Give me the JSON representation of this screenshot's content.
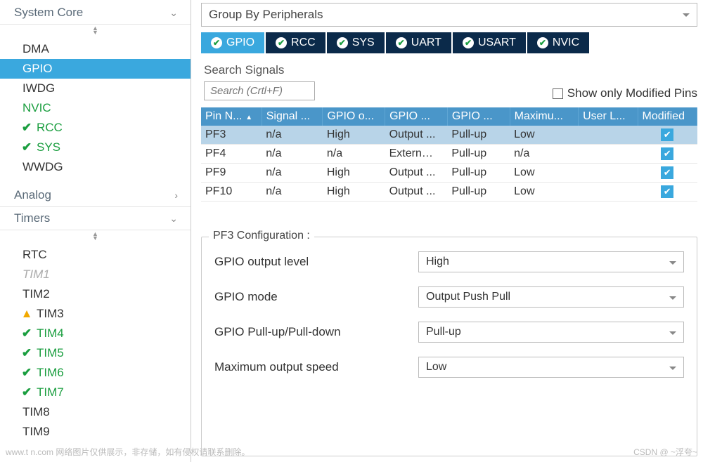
{
  "sidebar": {
    "cats": [
      {
        "name": "System Core",
        "open": true,
        "items": [
          {
            "label": "DMA",
            "style": "",
            "icon": ""
          },
          {
            "label": "GPIO",
            "style": "sel",
            "icon": ""
          },
          {
            "label": "IWDG",
            "style": "",
            "icon": ""
          },
          {
            "label": "NVIC",
            "style": "green",
            "icon": ""
          },
          {
            "label": "RCC",
            "style": "green",
            "icon": "check"
          },
          {
            "label": "SYS",
            "style": "green",
            "icon": "check"
          },
          {
            "label": "WWDG",
            "style": "",
            "icon": ""
          }
        ]
      },
      {
        "name": "Analog",
        "open": false,
        "items": []
      },
      {
        "name": "Timers",
        "open": true,
        "items": [
          {
            "label": "RTC",
            "style": "",
            "icon": ""
          },
          {
            "label": "TIM1",
            "style": "gray",
            "icon": ""
          },
          {
            "label": "TIM2",
            "style": "",
            "icon": ""
          },
          {
            "label": "TIM3",
            "style": "",
            "icon": "warn"
          },
          {
            "label": "TIM4",
            "style": "green",
            "icon": "check"
          },
          {
            "label": "TIM5",
            "style": "green",
            "icon": "check"
          },
          {
            "label": "TIM6",
            "style": "green",
            "icon": "check"
          },
          {
            "label": "TIM7",
            "style": "green",
            "icon": "check"
          },
          {
            "label": "TIM8",
            "style": "",
            "icon": ""
          },
          {
            "label": "TIM9",
            "style": "",
            "icon": ""
          }
        ]
      }
    ]
  },
  "groupBy": "Group By Peripherals",
  "tabs": [
    {
      "label": "GPIO",
      "active": true
    },
    {
      "label": "RCC",
      "active": false
    },
    {
      "label": "SYS",
      "active": false
    },
    {
      "label": "UART",
      "active": false
    },
    {
      "label": "USART",
      "active": false
    },
    {
      "label": "NVIC",
      "active": false
    }
  ],
  "search": {
    "label": "Search Signals",
    "placeholder": "Search (Crtl+F)"
  },
  "showModified": "Show only Modified Pins",
  "headers": [
    "Pin N...",
    "Signal ...",
    "GPIO o...",
    "GPIO ...",
    "GPIO ...",
    "Maximu...",
    "User L...",
    "Modified"
  ],
  "rows": [
    {
      "sel": true,
      "c": [
        "PF3",
        "n/a",
        "High",
        "Output ...",
        "Pull-up",
        "Low",
        ""
      ],
      "mod": true
    },
    {
      "sel": false,
      "c": [
        "PF4",
        "n/a",
        "n/a",
        "Extern…",
        "Pull-up",
        "n/a",
        ""
      ],
      "mod": true
    },
    {
      "sel": false,
      "c": [
        "PF9",
        "n/a",
        "High",
        "Output ...",
        "Pull-up",
        "Low",
        ""
      ],
      "mod": true
    },
    {
      "sel": false,
      "c": [
        "PF10",
        "n/a",
        "High",
        "Output ...",
        "Pull-up",
        "Low",
        ""
      ],
      "mod": true
    }
  ],
  "config": {
    "title": "PF3 Configuration :",
    "fields": [
      {
        "label": "GPIO output level",
        "value": "High"
      },
      {
        "label": "GPIO mode",
        "value": "Output Push Pull"
      },
      {
        "label": "GPIO Pull-up/Pull-down",
        "value": "Pull-up"
      },
      {
        "label": "Maximum output speed",
        "value": "Low"
      }
    ]
  },
  "watermark1": "www.t        n.com  网络图片仅供展示，非存储，如有侵权请联系删除。",
  "watermark2": "CSDN @ ~浮夸~"
}
